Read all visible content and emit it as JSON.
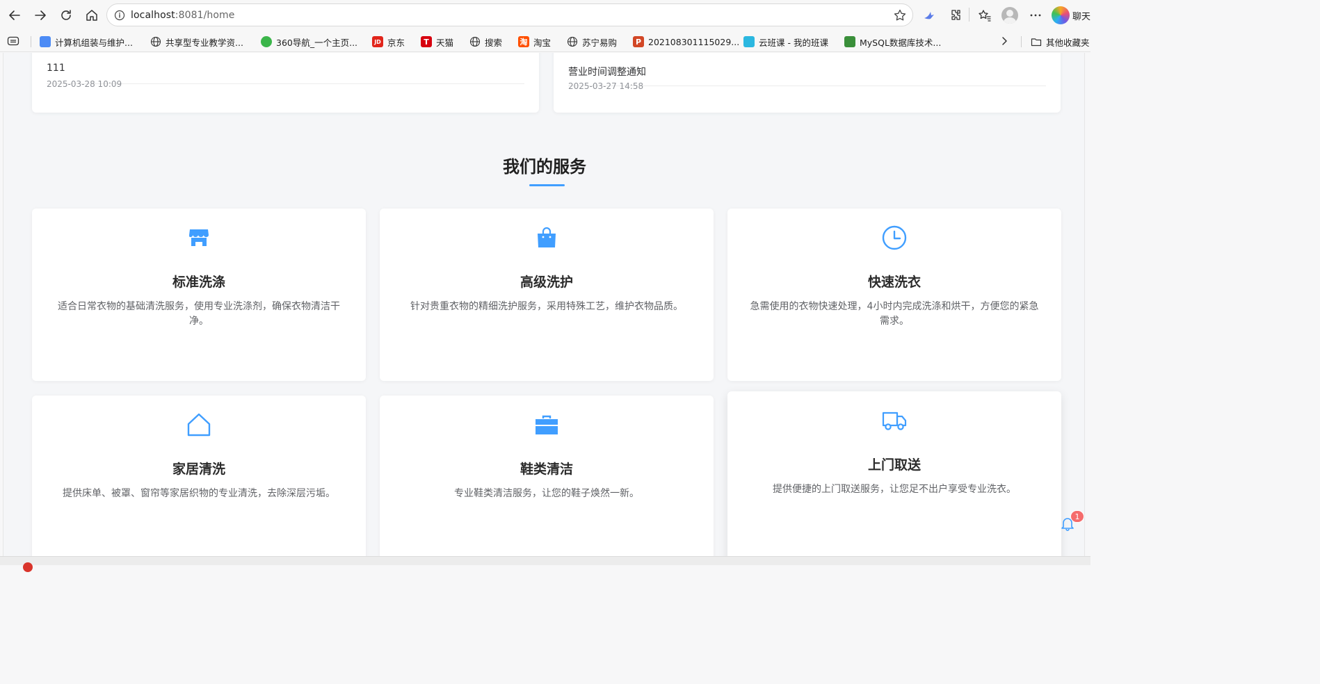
{
  "browser": {
    "url_host": "localhost",
    "url_port_path": ":8081/home",
    "copilot_label": "聊天",
    "bookmarks": [
      {
        "label": "计算机组装与维护...",
        "icon": "puzzle-icon",
        "color": "#4c8bf5"
      },
      {
        "label": "共享型专业教学资...",
        "icon": "globe-icon",
        "color": "#555555"
      },
      {
        "label": "360导航_一个主页...",
        "icon": "360-icon",
        "color": "#3bb54a"
      },
      {
        "label": "京东",
        "icon": "jd-icon",
        "color": "#e1251b",
        "glyph": "JD"
      },
      {
        "label": "天猫",
        "icon": "tmall-icon",
        "color": "#d7000f",
        "glyph": "T"
      },
      {
        "label": "搜索",
        "icon": "globe-icon",
        "color": "#555555"
      },
      {
        "label": "淘宝",
        "icon": "taobao-icon",
        "color": "#ff5000",
        "glyph": "淘"
      },
      {
        "label": "苏宁易购",
        "icon": "globe-icon",
        "color": "#555555"
      },
      {
        "label": "20210830111502​9...",
        "icon": "powerpoint-icon",
        "color": "#d24726",
        "glyph": "P"
      },
      {
        "label": "云班课 - 我的班课",
        "icon": "cloud-icon",
        "color": "#2bb7e0"
      },
      {
        "label": "MySQL数据库技术...",
        "icon": "book-icon",
        "color": "#3a8f3a"
      }
    ],
    "other_bookmarks": "其他收藏夹"
  },
  "notices": [
    {
      "title": "111",
      "date": "2025-03-28 10:09"
    },
    {
      "title": "营业时间调整通知",
      "date": "2025-03-27 14:58"
    }
  ],
  "services_section": {
    "title": "我们的服务",
    "accent": "#409eff",
    "items": [
      {
        "name": "标准洗涤",
        "icon": "shop-icon",
        "desc": "适合日常衣物的基础清洗服务，使用专业洗涤剂，确保衣物清洁干净。"
      },
      {
        "name": "高级洗护",
        "icon": "shopping-bag-icon",
        "desc": "针对贵重衣物的精细洗护服务，采用特殊工艺，维护衣物品质。"
      },
      {
        "name": "快速洗衣",
        "icon": "clock-icon",
        "desc": "急需使用的衣物快速处理，4小时内完成洗涤和烘干，方便您的紧急需求。"
      },
      {
        "name": "家居清洗",
        "icon": "house-icon",
        "desc": "提供床单、被罩、窗帘等家居织物的专业清洗，去除深层污垢。"
      },
      {
        "name": "鞋类清洁",
        "icon": "briefcase-icon",
        "desc": "专业鞋类清洁服务，让您的鞋子焕然一新。"
      },
      {
        "name": "上门取送",
        "icon": "truck-icon",
        "desc": "提供便捷的上门取送服务，让您足不出户享受专业洗衣。"
      }
    ]
  },
  "notification": {
    "count": "1"
  }
}
